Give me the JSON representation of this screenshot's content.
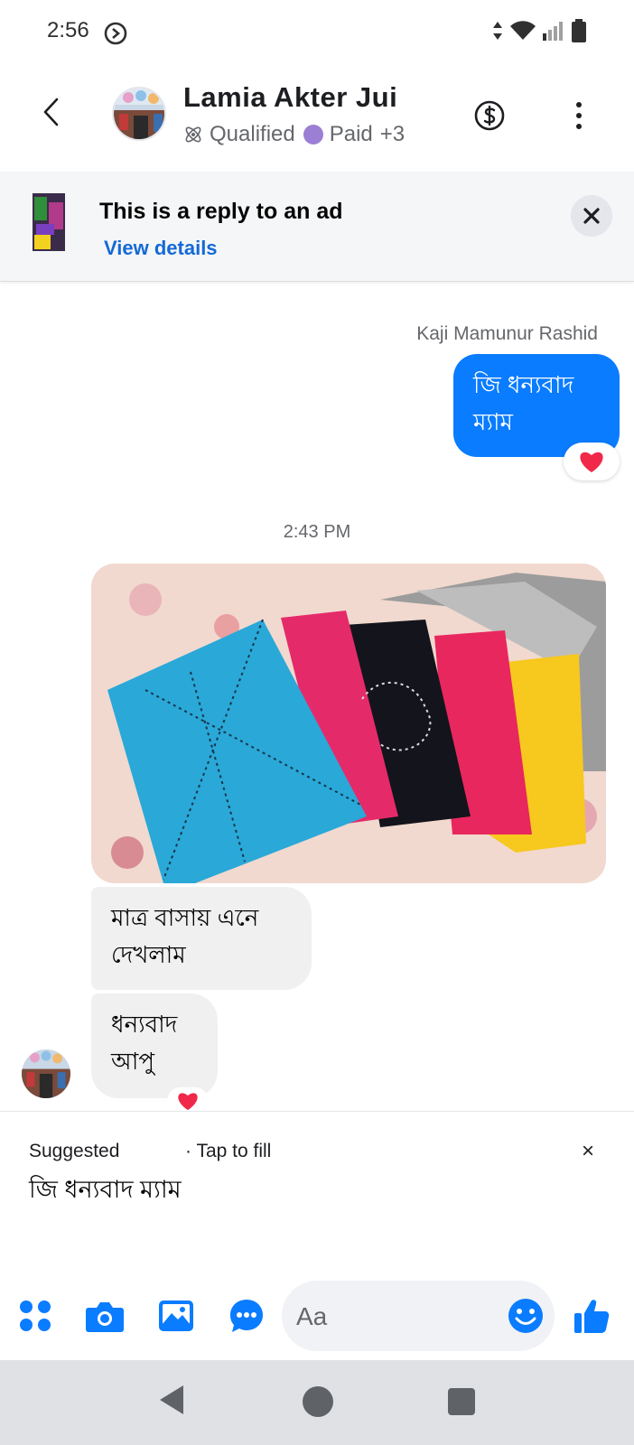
{
  "status_bar": {
    "time": "2:56"
  },
  "header": {
    "name": "Lamia Akter Jui",
    "tag_qualified": "Qualified",
    "tag_paid": "Paid",
    "tag_more": "+3"
  },
  "ad_banner": {
    "title": "This is a reply to an ad",
    "link": "View details"
  },
  "messages": {
    "outgoing_sender": "Kaji Mamunur Rashid",
    "outgoing_text": "জি ধন্যবাদ ম্যাম",
    "timestamp": "2:43 PM",
    "incoming": [
      {
        "text": "মাত্র বাসায় এনে দেখলাম"
      },
      {
        "text": "ধন্যবাদ আপু"
      }
    ]
  },
  "suggested": {
    "label": "Suggested",
    "tap": "· Tap to fill",
    "close": "×",
    "text": "জি ধন্যবাদ ম্যাম"
  },
  "composer": {
    "placeholder": "Aa"
  },
  "colors": {
    "messenger_blue": "#0a7cff",
    "link_blue": "#1469d6",
    "incoming_bubble": "#f0f0f0",
    "paid_dot": "#9b7fd4"
  }
}
